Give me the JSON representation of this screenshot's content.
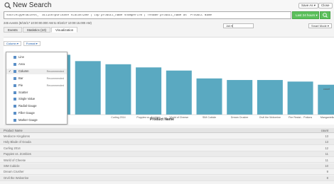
{
  "header": {
    "title": "New Search",
    "save_as_label": "Save As ▾",
    "close_label": "Close"
  },
  "search": {
    "query": "sourcetype=access_* action=purchase status=200 | top product_name showperc=0 | rename product_name as \"Product Name\"",
    "time_label": "Last 24 hours ▾"
  },
  "status_line": "245 events (8/15/17 10:00:00.000 AM to 8/16/17 10:00:15.000 AM)",
  "job_controls": {
    "job_label": "Job ▾",
    "mode_label": "Smart Mode ▾"
  },
  "tabs": [
    {
      "label": "Events"
    },
    {
      "label": "Statistics (10)"
    },
    {
      "label": "Visualization"
    }
  ],
  "viz_toolbar": {
    "column_label": "Column ▾",
    "format_label": "Format ▾"
  },
  "dropdown": {
    "items": [
      {
        "label": "Line",
        "recommended": "",
        "selected": false
      },
      {
        "label": "Area",
        "recommended": "",
        "selected": false
      },
      {
        "label": "Column",
        "recommended": "Recommended",
        "selected": true
      },
      {
        "label": "Bar",
        "recommended": "Recommended",
        "selected": false
      },
      {
        "label": "Pie",
        "recommended": "Recommended",
        "selected": false
      },
      {
        "label": "Scatter",
        "recommended": "",
        "selected": false
      },
      {
        "label": "Single Value",
        "recommended": "",
        "selected": false
      },
      {
        "label": "Radial Gauge",
        "recommended": "",
        "selected": false
      },
      {
        "label": "Filler Gauge",
        "recommended": "",
        "selected": false
      },
      {
        "label": "Marker Gauge",
        "recommended": "",
        "selected": false
      }
    ]
  },
  "chart_data": {
    "type": "bar",
    "xlabel": "Product Name",
    "categories": [
      "Mediocre Kingdoms",
      "Holy Blade of Gouda",
      "Curling 2014",
      "Puppies vs. Zombies",
      "World of Cheese",
      "SIM Cubicle",
      "Dream Crusher",
      "Orvil the Wolverine",
      "Fire Resist...Potions",
      "Manganiello Bros."
    ],
    "category_labels": [
      "",
      "",
      "Curling 2014",
      "Puppies vs. Zombies",
      "World of Cheese",
      "SIM Cubicle",
      "Dream Crusher",
      "Orvil the Wolverine",
      "Fire Resist... Potions",
      "Manganiello Bros."
    ],
    "values": [
      38,
      34,
      32,
      30,
      28,
      23,
      22,
      22,
      21,
      19
    ],
    "ylim": [
      0,
      40
    ],
    "color": "#5aa9c1",
    "legend": "count",
    "legend_placement": "right"
  },
  "table": {
    "header_name": "Product Name",
    "header_count": "count",
    "rows": [
      {
        "name": "Mediocre Kingdoms",
        "count": "13"
      },
      {
        "name": "Holy Blade of Gouda",
        "count": "13"
      },
      {
        "name": "Curling 2014",
        "count": "12"
      },
      {
        "name": "Puppies vs. Zombies",
        "count": "11"
      },
      {
        "name": "World of Cheese",
        "count": "11"
      },
      {
        "name": "SIM Cubicle",
        "count": "10"
      },
      {
        "name": "Dream Crusher",
        "count": "9"
      },
      {
        "name": "Orvil the Wolverine",
        "count": "8"
      }
    ]
  }
}
